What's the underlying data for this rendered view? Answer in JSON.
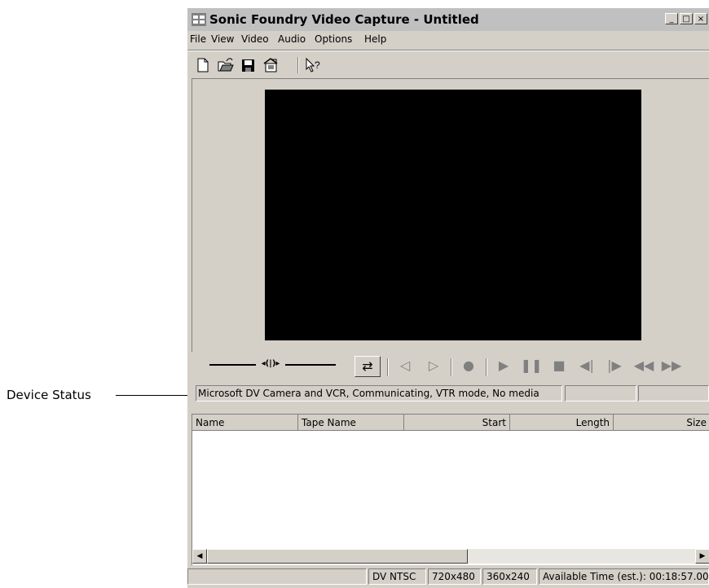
{
  "callout": {
    "label": "Device Status"
  },
  "window": {
    "title": "Sonic Foundry Video Capture - Untitled",
    "controls": {
      "minimize": "_",
      "maximize": "□",
      "close": "×"
    }
  },
  "menu": [
    "File",
    "View",
    "Video",
    "Audio",
    "Options",
    "Help"
  ],
  "toolbar": {
    "icons": [
      "new-file-icon",
      "open-folder-icon",
      "save-disk-icon",
      "properties-icon",
      "help-pointer-icon"
    ]
  },
  "transport": {
    "slider_thumb": "◂(|)▸",
    "buttons": [
      {
        "name": "device-control-icon",
        "glyph": "⇄"
      },
      {
        "name": "rewind-to-mark-icon",
        "glyph": "◁"
      },
      {
        "name": "forward-to-mark-icon",
        "glyph": "▷"
      },
      {
        "name": "record-icon",
        "glyph": "●"
      },
      {
        "name": "play-icon",
        "glyph": "▶"
      },
      {
        "name": "pause-icon",
        "glyph": "❚❚"
      },
      {
        "name": "stop-icon",
        "glyph": "■"
      },
      {
        "name": "step-back-icon",
        "glyph": "◀|"
      },
      {
        "name": "step-forward-icon",
        "glyph": "|▶"
      },
      {
        "name": "rewind-icon",
        "glyph": "◀◀"
      },
      {
        "name": "fast-forward-icon",
        "glyph": "▶▶"
      }
    ]
  },
  "device_status": {
    "text": "Microsoft DV Camera and VCR, Communicating, VTR mode, No media",
    "panel2": "",
    "panel3": ""
  },
  "list": {
    "columns": [
      "Name",
      "Tape Name",
      "Start",
      "Length",
      "Size"
    ]
  },
  "statusbar": {
    "format": "DV NTSC",
    "resolution1": "720x480",
    "resolution2": "360x240",
    "available_time": "Available Time (est.): 00:18:57.00"
  }
}
